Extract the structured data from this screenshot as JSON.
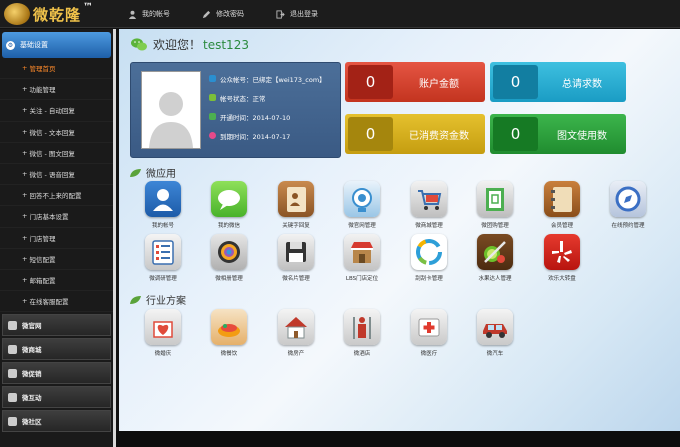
{
  "logo": {
    "text": "微乾隆",
    "tm": "™"
  },
  "topnav": [
    {
      "label": "我的帐号",
      "icon": "user-icon"
    },
    {
      "label": "修改密码",
      "icon": "pencil-icon"
    },
    {
      "label": "退出登录",
      "icon": "logout-icon"
    }
  ],
  "sidebar": {
    "head": "基础设置",
    "items": [
      {
        "label": "管理首页",
        "active": true
      },
      {
        "label": "功能管理"
      },
      {
        "label": "关注 - 自动回复"
      },
      {
        "label": "微信 - 文本回复"
      },
      {
        "label": "微信 - 图文回复"
      },
      {
        "label": "微信 - 语音回复"
      },
      {
        "label": "回答不上来的配置"
      },
      {
        "label": "门店基本设置"
      },
      {
        "label": "门店管理"
      },
      {
        "label": "短信配置"
      },
      {
        "label": "邮箱配置"
      },
      {
        "label": "在线客服配置"
      }
    ],
    "sections": [
      {
        "label": "微官网"
      },
      {
        "label": "微商城"
      },
      {
        "label": "微促销"
      },
      {
        "label": "微互动"
      },
      {
        "label": "微社区"
      }
    ]
  },
  "welcome": {
    "text": "欢迎您！",
    "user": "test123"
  },
  "profile": {
    "rows": [
      {
        "label": "公众帐号：已绑定【wei173_com】",
        "color": "#2a8fd0"
      },
      {
        "label": "帐号状态：正常",
        "color": "#7bbf3a"
      },
      {
        "label": "开通时间：2014-07-10",
        "color": "#4caf50"
      },
      {
        "label": "到期时间：2014-07-17",
        "color": "#e64a8a"
      }
    ]
  },
  "stats": [
    {
      "value": "0",
      "label": "账户金额",
      "color": "#d9402f",
      "num_color": "#a32216"
    },
    {
      "value": "0",
      "label": "总请求数",
      "color": "#2bb3d6",
      "num_color": "#127ea1"
    },
    {
      "value": "0",
      "label": "已消费资金数",
      "color": "#d9b21c",
      "num_color": "#a5860d"
    },
    {
      "value": "0",
      "label": "图文使用数",
      "color": "#2ea03e",
      "num_color": "#167a24"
    }
  ],
  "sections": {
    "apps_title": "微应用",
    "industry_title": "行业方案"
  },
  "apps": [
    {
      "name": "我的帐号",
      "icon": "profile-icon"
    },
    {
      "name": "我的微信",
      "icon": "chat-bubble-icon"
    },
    {
      "name": "关键字回复",
      "icon": "notebook-icon"
    },
    {
      "name": "微官网管理",
      "icon": "camera-icon"
    },
    {
      "name": "微商城管理",
      "icon": "cart-icon"
    },
    {
      "name": "微团购管理",
      "icon": "door-icon"
    },
    {
      "name": "会员管理",
      "icon": "address-book-icon"
    },
    {
      "name": "在线预约管理",
      "icon": "compass-icon"
    },
    {
      "name": "微调研管理",
      "icon": "list-icon"
    },
    {
      "name": "微相册管理",
      "icon": "aperture-icon"
    },
    {
      "name": "微名片管理",
      "icon": "floppy-icon"
    },
    {
      "name": "LBS门店定位",
      "icon": "shop-icon"
    },
    {
      "name": "刮刮卡管理",
      "icon": "ring-icon"
    },
    {
      "name": "水果达人管理",
      "icon": "fruit-icon"
    },
    {
      "name": "欢乐大转盘",
      "icon": "yelp-icon"
    }
  ],
  "industry": [
    {
      "name": "微婚庆",
      "icon": "heart-gift-icon"
    },
    {
      "name": "微餐饮",
      "icon": "food-icon"
    },
    {
      "name": "微房产",
      "icon": "house-icon"
    },
    {
      "name": "微酒店",
      "icon": "hotel-icon"
    },
    {
      "name": "微医疗",
      "icon": "medical-icon"
    },
    {
      "name": "微汽车",
      "icon": "car-icon"
    }
  ]
}
